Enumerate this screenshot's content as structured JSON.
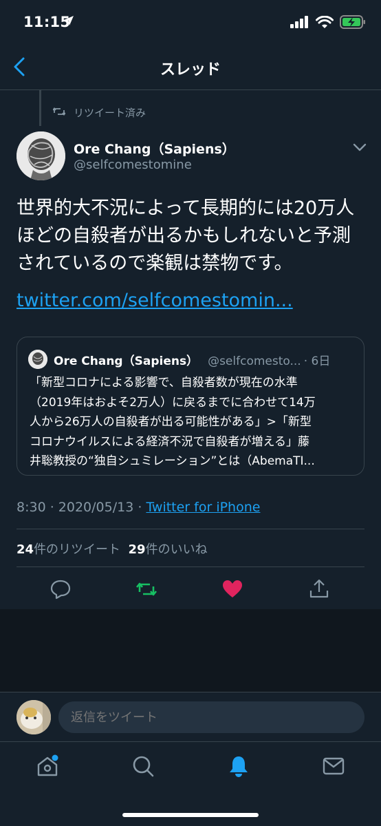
{
  "status": {
    "time": "11:15"
  },
  "header": {
    "title": "スレッド"
  },
  "retweet_context": {
    "label": "リツイート済み"
  },
  "tweet": {
    "author_name": "Ore Chang（Sapiens）",
    "author_handle": "@selfcomestomine",
    "text": "世界的大不況によって長期的には20万人ほどの自殺者が出るかもしれないと予測されているので楽観は禁物です。",
    "link": "twitter.com/selfcomestomin...",
    "time": "8:30",
    "date": "2020/05/13",
    "source": "Twitter for iPhone",
    "retweet_count": "24",
    "retweet_label": "件のリツイート",
    "like_count": "29",
    "like_label": "件のいいね"
  },
  "quote": {
    "author_name": "Ore Chang（Sapiens）",
    "author_handle": "@selfcomesto...",
    "time": "6日",
    "lines": [
      "「新型コロナによる影響で、自殺者数が現在の水準",
      "（2019年はおよそ2万人）に戻るまでに合わせて14万",
      "人から26万人の自殺者が出る可能性がある」>「新型",
      "コロナウイルスによる経済不況で自殺者が増える」藤",
      "井聡教授の“独自シュミレーション”とは（AbemaTI..."
    ]
  },
  "reply": {
    "placeholder": "返信をツイート"
  },
  "colors": {
    "background": "#15202b",
    "accent": "#1da1f2",
    "retweet_active": "#17bf63",
    "like_active": "#e0245e",
    "muted": "#8899a6",
    "border": "#38444d"
  }
}
